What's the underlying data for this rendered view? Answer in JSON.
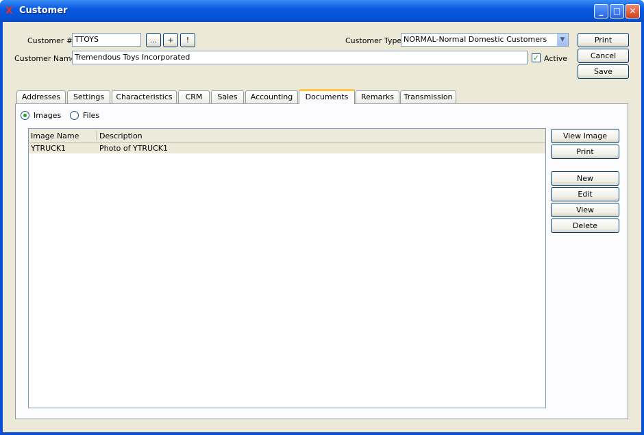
{
  "window": {
    "title": "Customer"
  },
  "header": {
    "customer_number_label": "Customer #:",
    "customer_number": "TTOYS",
    "lookup_buttons": [
      "...",
      "+",
      "!"
    ],
    "customer_name_label": "Customer Name:",
    "customer_name": "Tremendous Toys Incorporated",
    "customer_type_label": "Customer Type:",
    "customer_type": "NORMAL-Normal Domestic Customers",
    "active_label": "Active",
    "active": true
  },
  "actions": {
    "print": "Print",
    "cancel": "Cancel",
    "save": "Save"
  },
  "tabs": [
    "Addresses",
    "Settings",
    "Characteristics",
    "CRM",
    "Sales",
    "Accounting",
    "Documents",
    "Remarks",
    "Transmission"
  ],
  "active_tab": "Documents",
  "documents": {
    "radio_images": "Images",
    "radio_files": "Files",
    "selected": "Images",
    "columns": [
      "Image Name",
      "Description"
    ],
    "rows": [
      {
        "name": "YTRUCK1",
        "description": "Photo of YTRUCK1"
      }
    ],
    "buttons": {
      "view_image": "View Image",
      "print": "Print",
      "new": "New",
      "edit": "Edit",
      "view": "View",
      "delete": "Delete"
    }
  }
}
